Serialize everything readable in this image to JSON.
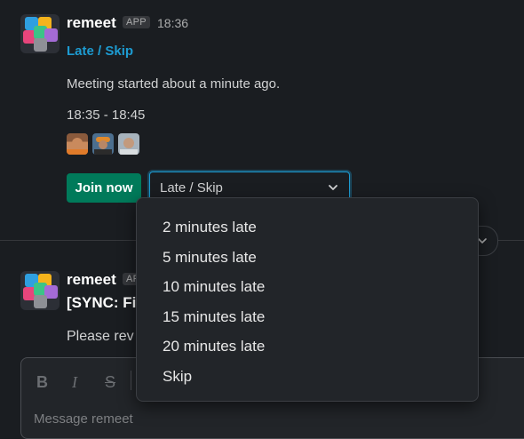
{
  "message1": {
    "sender": "remeet",
    "badge": "APP",
    "time": "18:36",
    "link": "Late / Skip",
    "text": "Meeting started about a minute ago.",
    "time_range": "18:35 - 18:45",
    "join_label": "Join now",
    "select_value": "Late / Skip"
  },
  "dropdown": {
    "options": [
      "2 minutes late",
      "5 minutes late",
      "10 minutes late",
      "15 minutes late",
      "20 minutes late",
      "Skip"
    ]
  },
  "message2": {
    "sender": "remeet",
    "badge": "APP",
    "title": "[SYNC: Fi",
    "text": "Please rev"
  },
  "composer": {
    "placeholder": "Message remeet",
    "bold": "B",
    "italic": "I",
    "strike": "S"
  },
  "colors": {
    "accent": "#1d9bd1",
    "join_green": "#007a5a",
    "background": "#1a1d21"
  }
}
